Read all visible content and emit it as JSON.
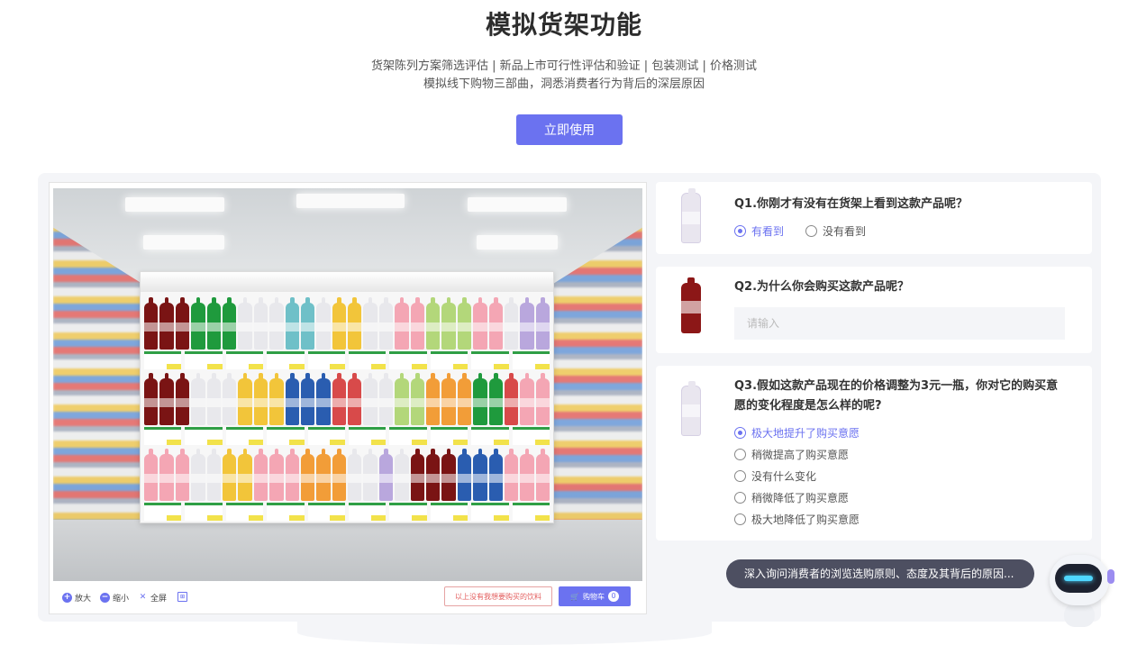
{
  "hero": {
    "title": "模拟货架功能",
    "subtitle_line1": "货架陈列方案筛选评估 | 新品上市可行性评估和验证 | 包装测试 | 价格测试",
    "subtitle_line2": "模拟线下购物三部曲，洞悉消费者行为背后的深层原因",
    "cta_label": "立即使用"
  },
  "store": {
    "toolbar": {
      "zoom_in": "放大",
      "zoom_out": "缩小",
      "fullscreen": "全屏",
      "no_want_label": "以上没有我想要购买的饮料",
      "cart_label": "购物车",
      "cart_count": "0"
    }
  },
  "questions": [
    {
      "title": "Q1.你刚才有没有在货架上看到这款产品呢？",
      "options": [
        "有看到",
        "没有看到"
      ],
      "selected": 0
    },
    {
      "title": "Q2.为什么你会购买这款产品呢？",
      "placeholder": "请输入"
    },
    {
      "title": "Q3.假如这款产品现在的价格调整为3元一瓶，你对它的购买意愿的变化程度是怎么样的呢?",
      "options": [
        "极大地提升了购买意愿",
        "稍微提高了购买意愿",
        "没有什么变化",
        "稍微降低了购买意愿",
        "极大地降低了购买意愿"
      ],
      "selected": 0
    }
  ],
  "assistant": {
    "bubble_text": "深入询问消费者的浏览选购原则、态度及其背后的原因..."
  },
  "colors": {
    "accent": "#6b72f0",
    "panel_bg": "#f4f5f8",
    "bubble_bg": "#4d4f61"
  }
}
